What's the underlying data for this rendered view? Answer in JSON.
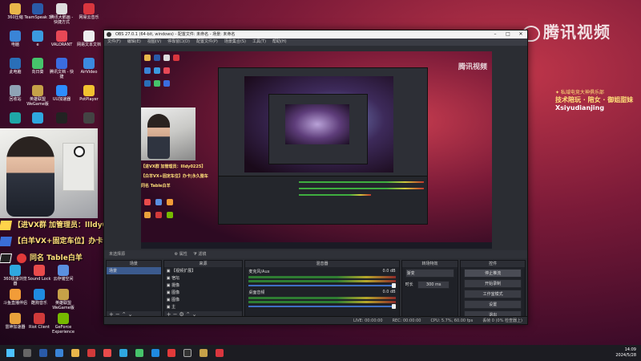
{
  "desktop": {
    "icons_col1": [
      "360压缩",
      "电脑",
      "此电脑",
      "回收站",
      "",
      ""
    ],
    "icons_col2": [
      "TeamSpeak 3",
      "e",
      "向日葵",
      "英雄联盟 WeGame版",
      "360极速浏览器",
      ""
    ],
    "icons_col3": [
      "腾讯大鹅画 - 快捷方式",
      "VALORANT",
      "腾讯文档 - 快捷",
      "UU加速器",
      "",
      ""
    ],
    "icons_col4": [
      "网易云音乐",
      "网易文本文档",
      "AirVideo",
      "PotPlayer",
      "",
      ""
    ],
    "bottom_icons": [
      "360极速浏览器",
      "Sound Lock",
      "云存储空间",
      "斗鱼直播伴侣",
      "酷狗音乐",
      "英雄联盟 WeGame版",
      "雷神加速器",
      "Riot Client",
      "GeForce Experience"
    ],
    "watermark": "腾讯视频",
    "club": {
      "line1": "✦ 私域电竞大神俱乐部",
      "line2": "技术陪玩 · 陪女 · 御姐甜妹",
      "handle": "Xsiyudianjing"
    },
    "ads": {
      "line1": "【进VX群 加管理员：llldy0225】",
      "line2": "【白羊VX+固定车位】办卡|永久腊车",
      "line3": "同名 Table白羊"
    }
  },
  "obs": {
    "title": "OBS 27.0.1 (64-bit, windows) - 配置文件: 未命名 - 场景: 未命名",
    "window_controls": [
      "–",
      "□",
      "✕"
    ],
    "menu": [
      "文件(F)",
      "编辑(E)",
      "视图(V)",
      "停靠窗口(D)",
      "配置文件(P)",
      "场景集合(S)",
      "工具(T)",
      "帮助(H)"
    ],
    "scene_bar": "未选择源",
    "scene_bar_buttons": [
      "属性",
      "滤镜"
    ],
    "docks": {
      "scenes": {
        "title": "场景",
        "items": [
          "场景"
        ]
      },
      "sources": {
        "title": "来源",
        "items": [
          "【视频扩展】",
          "宿坛",
          "摄像",
          "图像",
          "图像",
          "主"
        ]
      },
      "mixer": {
        "title": "混音器",
        "channels": [
          {
            "name": "麦克风/Aux",
            "level": "0.0 dB"
          },
          {
            "name": "桌面音频",
            "level": "0.0 dB"
          }
        ]
      },
      "transitions": {
        "title": "转场特效",
        "type": "渐变",
        "duration_label": "时长",
        "duration": "300 ms"
      },
      "controls": {
        "title": "控件",
        "buttons": [
          "停止推流",
          "开始录制",
          "工作室模式",
          "设置",
          "退出"
        ]
      }
    },
    "status": {
      "live": "LIVE: 00:00:00",
      "rec": "REC: 00:00:00",
      "cpu": "CPU: 5.7%, 60.00 fps",
      "dropped": "丢帧 0 (0% 检查器上)"
    }
  },
  "taskbar": {
    "time": "14:09",
    "date": "2024/5/28"
  },
  "colors": {
    "accent": "#3b5a8e",
    "meter_green": "#2e7d32",
    "meter_yellow": "#b5a62a",
    "meter_red": "#8e2a2a",
    "ad_yellow": "#ffe07a"
  }
}
